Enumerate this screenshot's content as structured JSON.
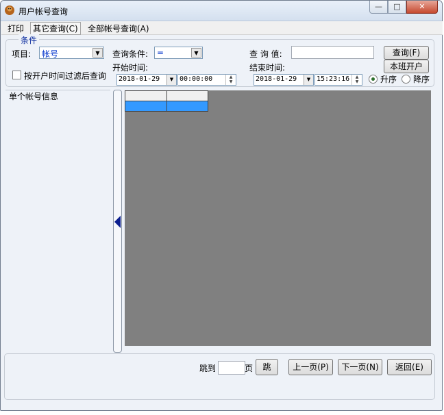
{
  "window": {
    "title": "用户帐号查询"
  },
  "menu": [
    "打印",
    "其它查询(C)",
    "全部帐号查询(A)"
  ],
  "conditions": {
    "legend": "条件",
    "item_label": "项目:",
    "item_value": "帐号",
    "criteria_label": "查询条件:",
    "criteria_value": "=",
    "query_value_label": "查 询 值:",
    "query_value": "",
    "query_button": "查询(F)",
    "open_account_button": "本班开户",
    "filter_checkbox_label": "按开户时间过滤后查询",
    "start_time_label": "开始时间:",
    "start_date": "2018-01-29",
    "start_time": "00:00:00",
    "end_time_label": "结束时间:",
    "end_date": "2018-01-29",
    "end_time": "15:23:16",
    "sort_asc": "升序",
    "sort_desc": "降序",
    "sort_selected": "asc"
  },
  "left_panel": {
    "title": "单个帐号信息"
  },
  "pagination": {
    "jump_label": "跳到",
    "page_suffix": "页",
    "page_value": "",
    "jump_button": "跳",
    "prev_button": "上一页(P)",
    "next_button": "下一页(N)",
    "back_button": "返回(E)"
  },
  "colors": {
    "grid_background": "#808080",
    "selection": "#3399ff",
    "accent": "#0a2b9e"
  }
}
